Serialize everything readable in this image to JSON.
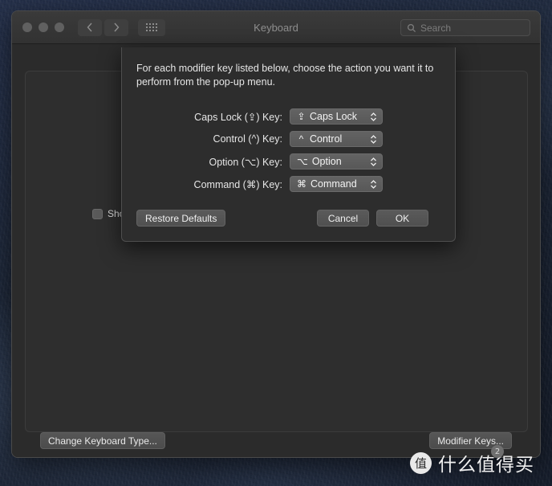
{
  "window": {
    "title": "Keyboard",
    "traffic_lights": [
      "close",
      "minimize",
      "zoom"
    ],
    "search": {
      "placeholder": "Search",
      "value": ""
    }
  },
  "content": {
    "checkbox_label": "Sho",
    "bottom_buttons": {
      "change_keyboard_type": "Change Keyboard Type...",
      "modifier_keys": "Modifier Keys..."
    }
  },
  "dialog": {
    "message": "For each modifier key listed below, choose the action you want it to perform from the pop-up menu.",
    "rows": [
      {
        "label": "Caps Lock (⇪) Key:",
        "symbol": "⇪",
        "value": "Caps Lock"
      },
      {
        "label": "Control (^) Key:",
        "symbol": "^",
        "value": "Control"
      },
      {
        "label": "Option (⌥) Key:",
        "symbol": "⌥",
        "value": "Option"
      },
      {
        "label": "Command (⌘) Key:",
        "symbol": "⌘",
        "value": "Command"
      }
    ],
    "buttons": {
      "restore_defaults": "Restore Defaults",
      "cancel": "Cancel",
      "ok": "OK"
    }
  },
  "watermark": {
    "logo": "值",
    "text": "什么值得买",
    "badge": "2"
  },
  "colors": {
    "window_bg": "#2b2b2b",
    "panel_bg": "#2e2e2e",
    "dialog_bg": "#2d2d2d",
    "titlebar_bg": "#363636",
    "text_primary": "#e6e6e6",
    "text_dim": "#8e8e8e",
    "control_bg": "#585858",
    "desktop": "#1d2738"
  }
}
